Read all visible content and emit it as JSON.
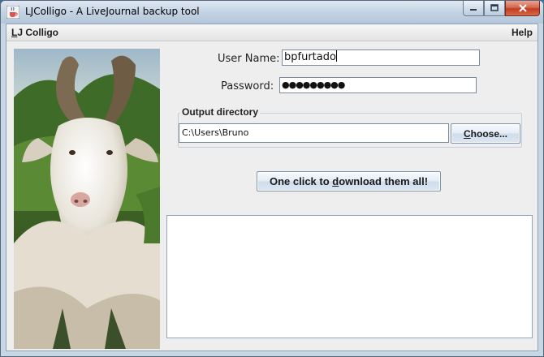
{
  "window": {
    "title": "LJColligo - A LiveJournal backup tool",
    "icon": "java-cup-icon",
    "controls": [
      "minimize-icon",
      "maximize-icon",
      "close-icon"
    ]
  },
  "menubar": {
    "app_menu": {
      "mnemonic": "L",
      "rest": "J Colligo"
    },
    "help_menu": "Help"
  },
  "image": {
    "description_icon": "goat-photo"
  },
  "form": {
    "username_label": "User Name:",
    "username_value": "bpfurtado",
    "password_label": "Password:",
    "password_mask": "●●●●●●●●●"
  },
  "output_dir": {
    "group_title": "Output directory",
    "path": "C:\\Users\\Bruno",
    "choose_button": {
      "mnemonic": "C",
      "rest": "hoose..."
    }
  },
  "download_button": {
    "before": "One click to ",
    "mnemonic": "d",
    "after": "ownload them all!"
  },
  "log": {
    "text": ""
  },
  "colors": {
    "titlebar": "#c4d3e3",
    "client_bg": "#eeeeee",
    "close_button": "#c43c1e",
    "button_face": "#dbe6f2"
  }
}
